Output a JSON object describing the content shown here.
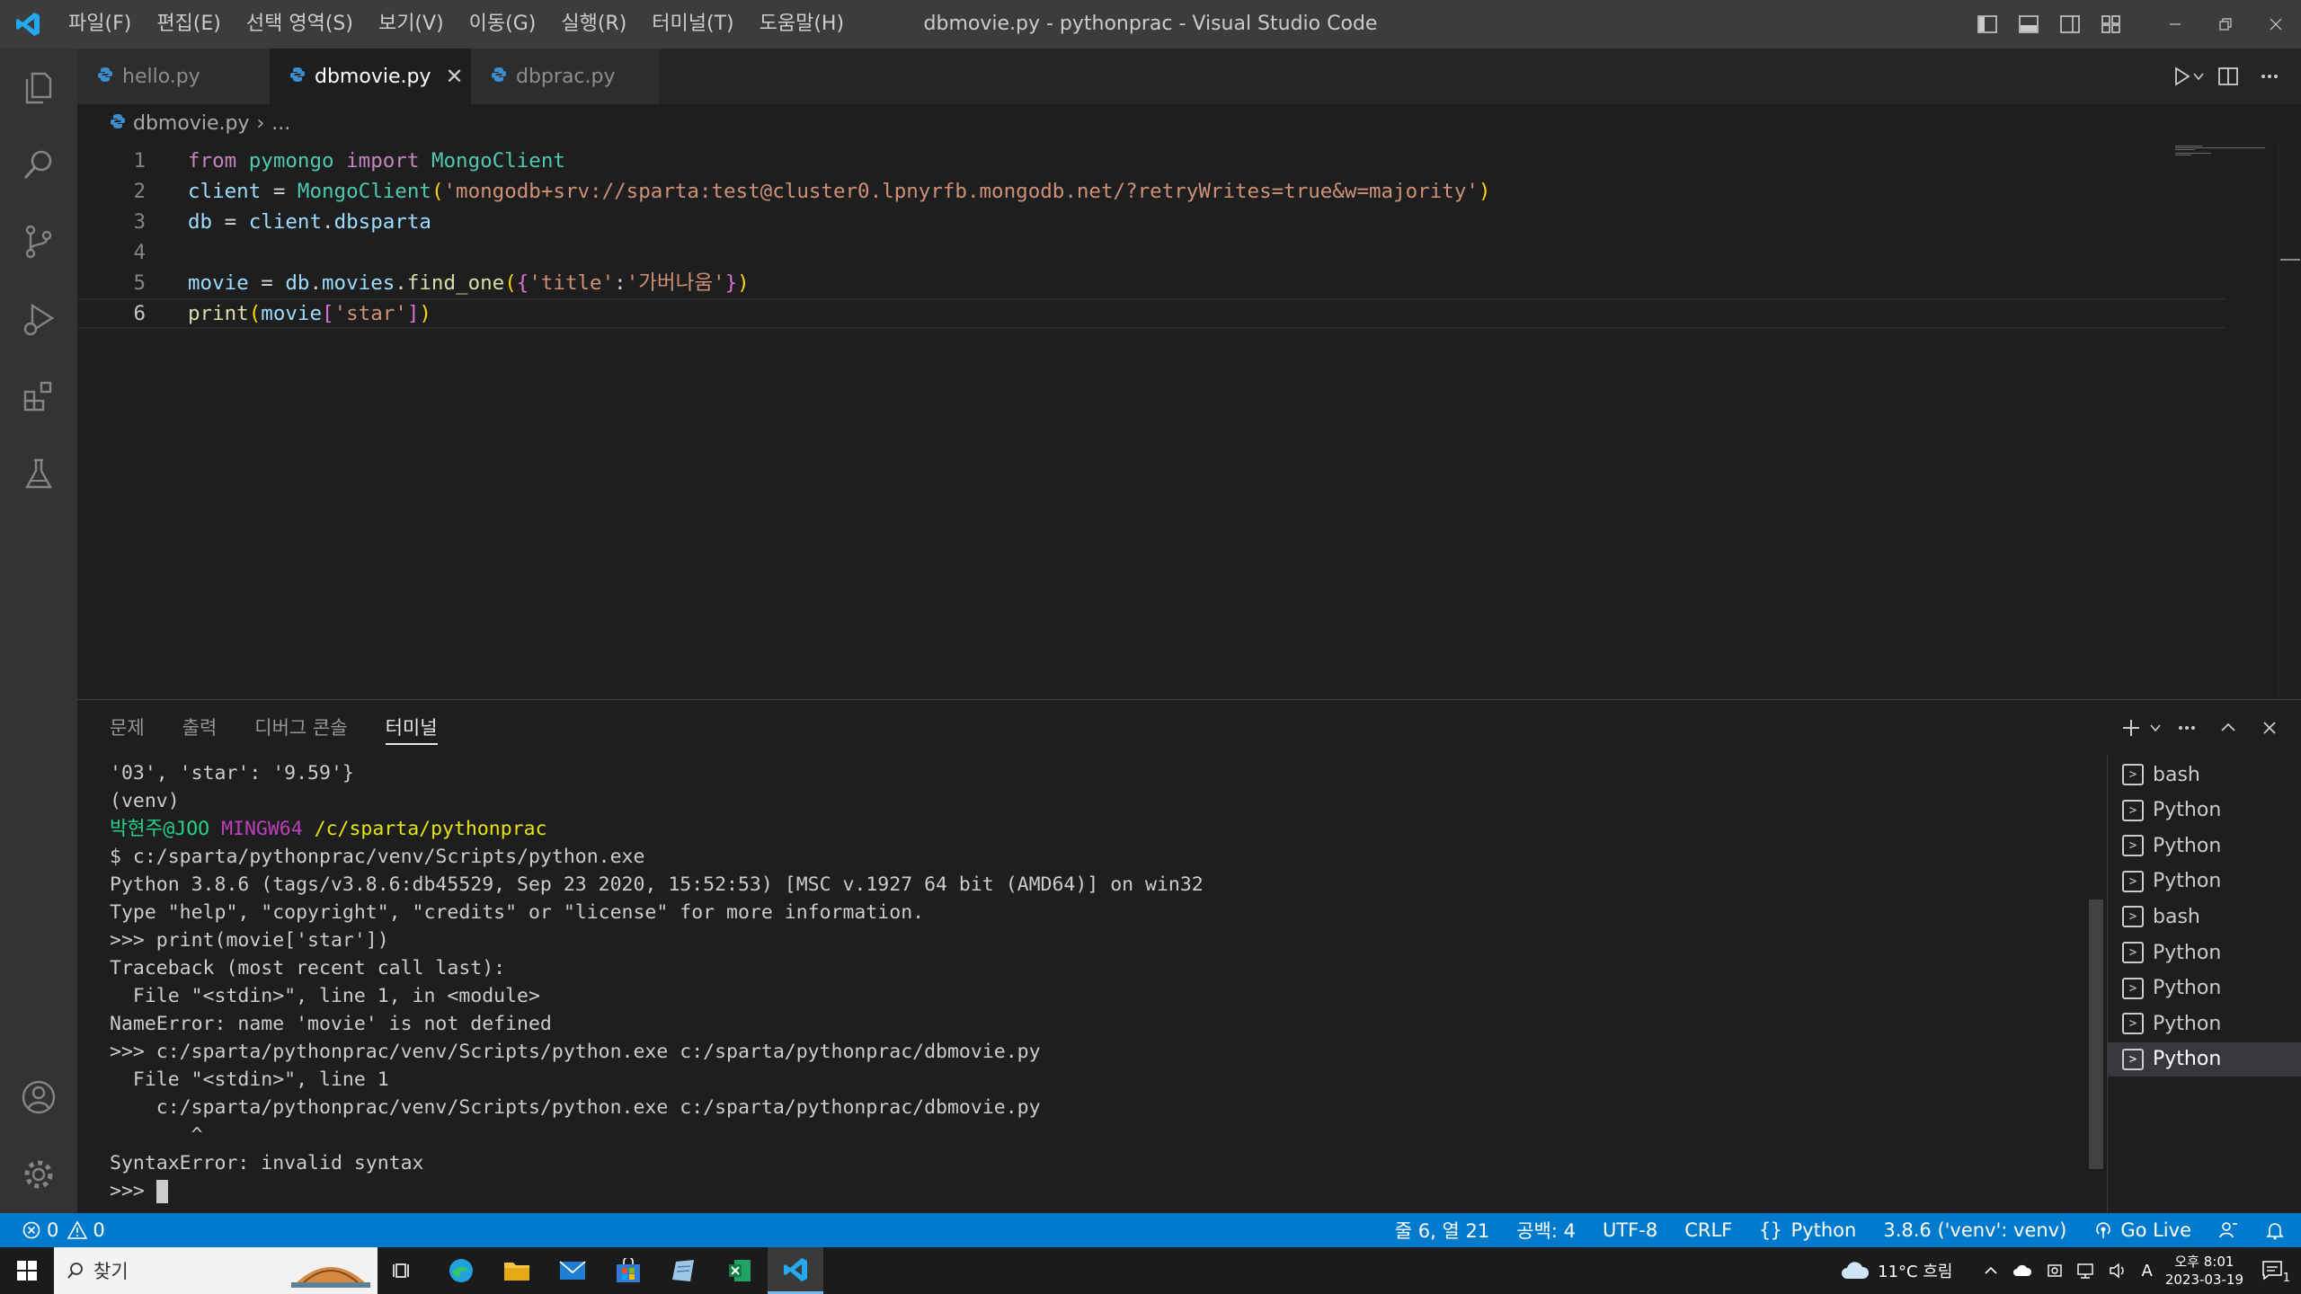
{
  "titlebar": {
    "menu": [
      "파일(F)",
      "편집(E)",
      "선택 영역(S)",
      "보기(V)",
      "이동(G)",
      "실행(R)",
      "터미널(T)",
      "도움말(H)"
    ],
    "window_title": "dbmovie.py - pythonprac - Visual Studio Code"
  },
  "tabs": [
    {
      "label": "hello.py",
      "active": false
    },
    {
      "label": "dbmovie.py",
      "active": true
    },
    {
      "label": "dbprac.py",
      "active": false
    }
  ],
  "tab_close_glyph": "✕",
  "breadcrumb": {
    "file": "dbmovie.py",
    "sep": "›",
    "rest": "..."
  },
  "editor": {
    "line_numbers": [
      "1",
      "2",
      "3",
      "4",
      "5",
      "6"
    ],
    "current_line": 6,
    "lines": [
      {
        "tokens": [
          [
            "kw",
            "from"
          ],
          [
            "p",
            " "
          ],
          [
            "mod",
            "pymongo"
          ],
          [
            "p",
            " "
          ],
          [
            "kw",
            "import"
          ],
          [
            "p",
            " "
          ],
          [
            "mod",
            "MongoClient"
          ]
        ]
      },
      {
        "tokens": [
          [
            "var",
            "client"
          ],
          [
            "p",
            " = "
          ],
          [
            "mod",
            "MongoClient"
          ],
          [
            "br1",
            "("
          ],
          [
            "str",
            "'mongodb+srv://sparta:test@cluster0.lpnyrfb.mongodb.net/?retryWrites=true&w=majority'"
          ],
          [
            "br1",
            ")"
          ]
        ]
      },
      {
        "tokens": [
          [
            "var",
            "db"
          ],
          [
            "p",
            " = "
          ],
          [
            "var",
            "client"
          ],
          [
            "p",
            "."
          ],
          [
            "var",
            "dbsparta"
          ]
        ]
      },
      {
        "tokens": []
      },
      {
        "tokens": [
          [
            "var",
            "movie"
          ],
          [
            "p",
            " = "
          ],
          [
            "var",
            "db"
          ],
          [
            "p",
            "."
          ],
          [
            "var",
            "movies"
          ],
          [
            "p",
            "."
          ],
          [
            "fn",
            "find_one"
          ],
          [
            "br1",
            "("
          ],
          [
            "br2",
            "{"
          ],
          [
            "str",
            "'title'"
          ],
          [
            "p",
            ":"
          ],
          [
            "str",
            "'가버나움'"
          ],
          [
            "br2",
            "}"
          ],
          [
            "br1",
            ")"
          ]
        ]
      },
      {
        "tokens": [
          [
            "fn",
            "print"
          ],
          [
            "br1",
            "("
          ],
          [
            "var",
            "movie"
          ],
          [
            "br2",
            "["
          ],
          [
            "str",
            "'star'"
          ],
          [
            "br2",
            "]"
          ],
          [
            "br1",
            ")"
          ]
        ]
      }
    ]
  },
  "panel": {
    "tabs": [
      "문제",
      "출력",
      "디버그 콘솔",
      "터미널"
    ],
    "active_tab": "터미널"
  },
  "terminal": {
    "lines": [
      [
        [
          "t",
          "'03', 'star': '9.59'}"
        ]
      ],
      [
        [
          "t",
          "(venv)"
        ]
      ],
      [
        [
          "g",
          "박현주@JOO"
        ],
        [
          "t",
          " "
        ],
        [
          "m",
          "MINGW64"
        ],
        [
          "t",
          " "
        ],
        [
          "y",
          "/c/sparta/pythonprac"
        ]
      ],
      [
        [
          "t",
          "$ c:/sparta/pythonprac/venv/Scripts/python.exe"
        ]
      ],
      [
        [
          "t",
          "Python 3.8.6 (tags/v3.8.6:db45529, Sep 23 2020, 15:52:53) [MSC v.1927 64 bit (AMD64)] on win32"
        ]
      ],
      [
        [
          "t",
          "Type \"help\", \"copyright\", \"credits\" or \"license\" for more information."
        ]
      ],
      [
        [
          "t",
          ">>> print(movie['star'])"
        ]
      ],
      [
        [
          "t",
          "Traceback (most recent call last):"
        ]
      ],
      [
        [
          "t",
          "  File \"<stdin>\", line 1, in <module>"
        ]
      ],
      [
        [
          "t",
          "NameError: name 'movie' is not defined"
        ]
      ],
      [
        [
          "t",
          ">>> c:/sparta/pythonprac/venv/Scripts/python.exe c:/sparta/pythonprac/dbmovie.py"
        ]
      ],
      [
        [
          "t",
          "  File \"<stdin>\", line 1"
        ]
      ],
      [
        [
          "t",
          "    c:/sparta/pythonprac/venv/Scripts/python.exe c:/sparta/pythonprac/dbmovie.py"
        ]
      ],
      [
        [
          "t",
          "       ^"
        ]
      ],
      [
        [
          "t",
          "SyntaxError: invalid syntax"
        ]
      ],
      [
        [
          "t",
          ">>> "
        ]
      ]
    ],
    "instances": [
      "bash",
      "Python",
      "Python",
      "Python",
      "bash",
      "Python",
      "Python",
      "Python",
      "Python"
    ],
    "selected_instance": 8
  },
  "statusbar": {
    "errors": "0",
    "warnings": "0",
    "position": "줄 6, 열 21",
    "spaces": "공백: 4",
    "encoding": "UTF-8",
    "eol": "CRLF",
    "language": "Python",
    "interpreter": "3.8.6 ('venv': venv)",
    "golive": "Go Live"
  },
  "taskbar": {
    "search_placeholder": "찾기",
    "weather": "11°C 흐림",
    "ime": "A",
    "time": "오후 8:01",
    "date": "2023-03-19",
    "notification_count": "1"
  }
}
